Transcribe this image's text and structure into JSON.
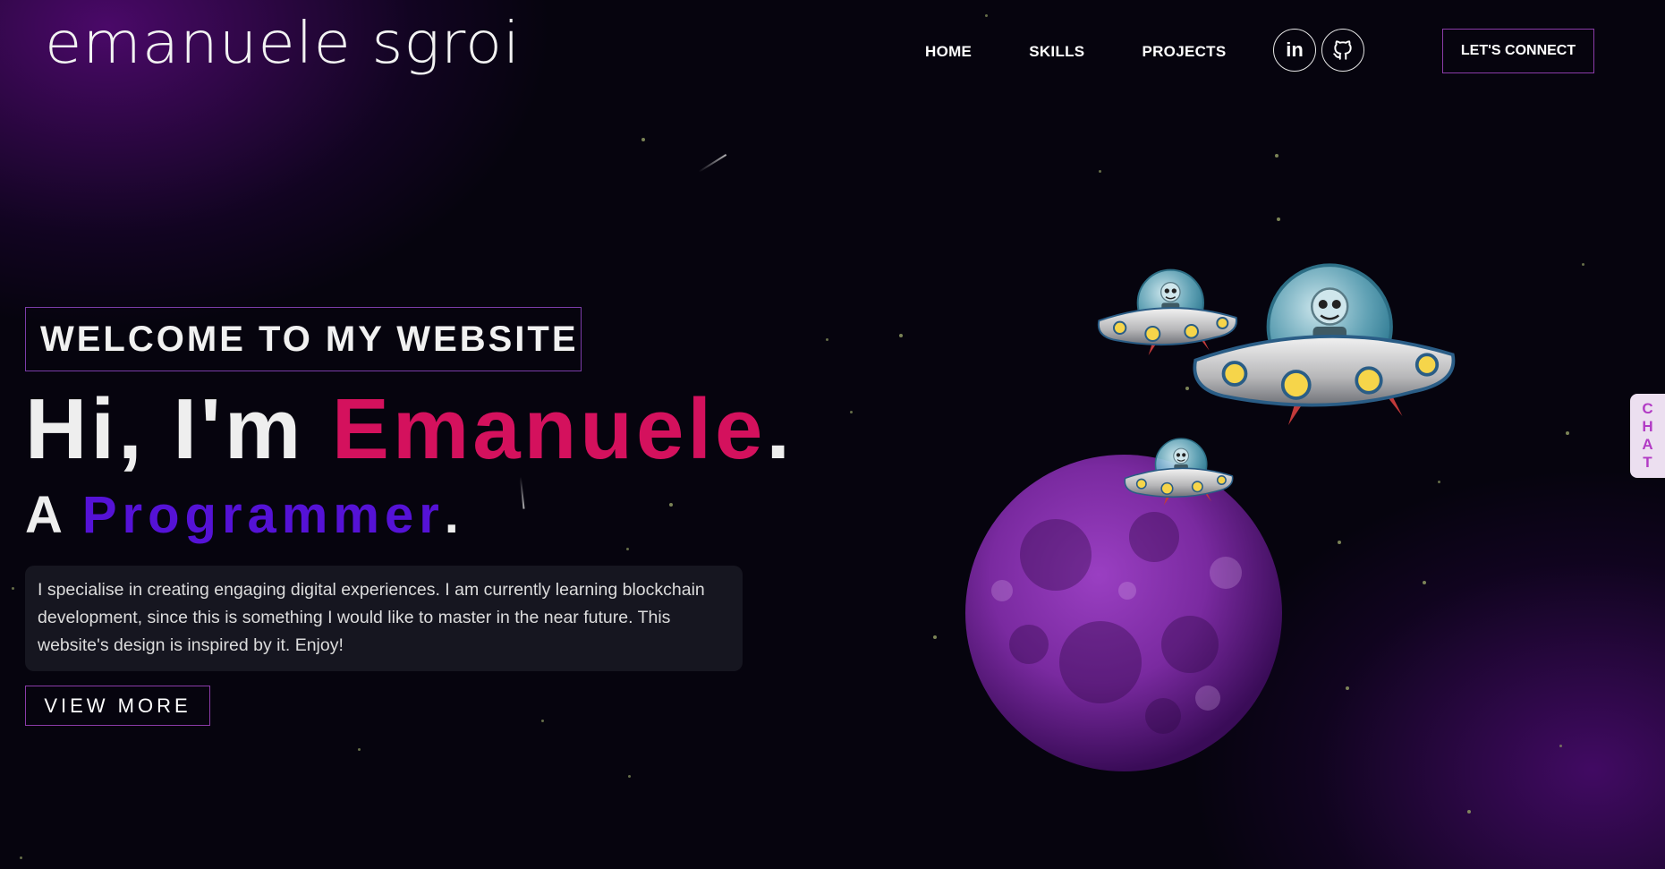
{
  "logo": {
    "text": "emanuele sgroi"
  },
  "nav": {
    "items": [
      "HOME",
      "SKILLS",
      "PROJECTS"
    ]
  },
  "social": {
    "linkedin_label": "in",
    "icons": [
      "linkedin-icon",
      "github-icon"
    ]
  },
  "header": {
    "connect_label": "LET'S CONNECT"
  },
  "hero": {
    "welcome": "WELCOME TO MY WEBSITE",
    "greeting_prefix": "Hi, I'm ",
    "name": "Emanuele",
    "greeting_suffix": ".",
    "role_prefix": "A ",
    "role": "Programmer",
    "role_suffix": ".",
    "description": "I specialise in creating engaging digital experiences. I am currently learning blockchain development, since this is something I would like to master in the near future. This website's design is inspired by it. Enjoy!",
    "view_more": "VIEW MORE"
  },
  "chat": {
    "letters": [
      "C",
      "H",
      "A",
      "T"
    ]
  },
  "colors": {
    "name_accent": "#d4115d",
    "role_accent": "#5512d6",
    "border_accent": "#8a3ba8",
    "moon": "#7a2aa0"
  }
}
